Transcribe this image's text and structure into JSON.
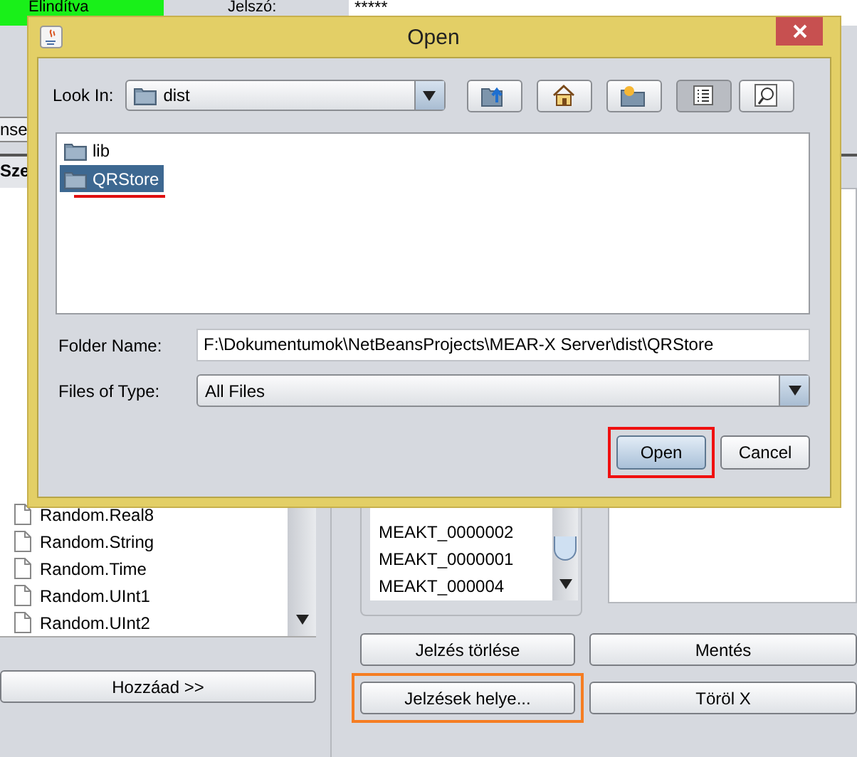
{
  "background": {
    "status": "Elindítva",
    "password_label": "Jelszó:",
    "password_value": "*****",
    "tab_button": "nse",
    "column_header": "Sze",
    "files": [
      "Random.Real8",
      "Random.String",
      "Random.Time",
      "Random.UInt1",
      "Random.UInt2"
    ],
    "codes": [
      "MEAKT_0000002",
      "MEAKT_0000001",
      "MEAKT_000004"
    ],
    "add_button": "Hozzáad >>",
    "actions": [
      {
        "label": "Jelzés törlése",
        "highlighted": false
      },
      {
        "label": "Mentés",
        "highlighted": false
      },
      {
        "label": "Jelzések helye...",
        "highlighted": true
      },
      {
        "label": "Töröl X",
        "highlighted": false
      }
    ]
  },
  "dialog": {
    "title": "Open",
    "look_in_label": "Look In:",
    "look_in_value": "dist",
    "toolbar": [
      {
        "kind": "up",
        "selected": false
      },
      {
        "kind": "home",
        "selected": false
      },
      {
        "kind": "new_folder",
        "selected": false
      },
      {
        "kind": "list",
        "selected": true
      },
      {
        "kind": "details",
        "selected": false
      }
    ],
    "entries": [
      {
        "name": "lib",
        "selected": false,
        "underlined": false
      },
      {
        "name": "QRStore",
        "selected": true,
        "underlined": true
      }
    ],
    "folder_name_label": "Folder Name:",
    "folder_name_value": "F:\\Dokumentumok\\NetBeansProjects\\MEAR-X Server\\dist\\QRStore",
    "files_of_type_label": "Files of Type:",
    "files_of_type_value": "All Files",
    "buttons": [
      {
        "label": "Open",
        "default": true,
        "highlighted": true
      },
      {
        "label": "Cancel",
        "default": false,
        "highlighted": false
      }
    ]
  }
}
